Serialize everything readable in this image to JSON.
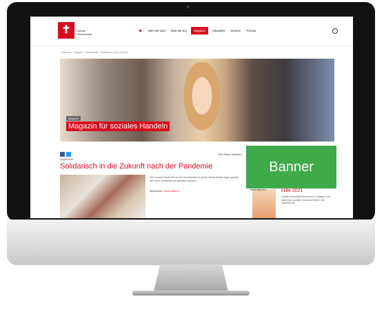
{
  "site": {
    "logo": {
      "symbol": "✝",
      "line1": "Caritas",
      "line2": "Deutschland"
    },
    "nav": {
      "items": [
        {
          "label": "Wer wir sind",
          "active": false
        },
        {
          "label": "Was wir tun",
          "active": false
        },
        {
          "label": "Magazin",
          "active": true
        },
        {
          "label": "Aktuelles",
          "active": false
        },
        {
          "label": "Service",
          "active": false
        },
        {
          "label": "Presse",
          "active": false
        }
      ]
    },
    "breadcrumb": "Startseite  ›  Magazin  ›  Gesellschaft  ›  Solidarisch in die Zukunft"
  },
  "hero": {
    "badge": "Magazin",
    "title": "Magazin für soziales Handeln"
  },
  "article": {
    "social": {
      "facebook": "f",
      "twitter": "t"
    },
    "meta": "Gesellschaft",
    "toolbar": "Text  Teilen  Drucken",
    "title": "Solidarisch in die Zukunft nach der Pandemie",
    "text": "Die Corona-Pandemie hat die Gesellschaft vor große Herausforderungen gestellt. Wie kann Solidarität jetzt gestärkt werden?",
    "link_prefix": "Weiterlesen:",
    "link_label": "Mehr erfahren"
  },
  "sidebar": {
    "label": "Neue Aktionen",
    "heading": "Hilfe 2021",
    "text": "Caritas unterstützt Menschen in Notlagen und stärkt den sozialen Zusammenhalt in der Gesellschaft."
  },
  "banner": {
    "label": "Banner",
    "color": "#3eaa4a"
  },
  "colors": {
    "brand_red": "#d60d1e",
    "bezel": "#111111"
  }
}
